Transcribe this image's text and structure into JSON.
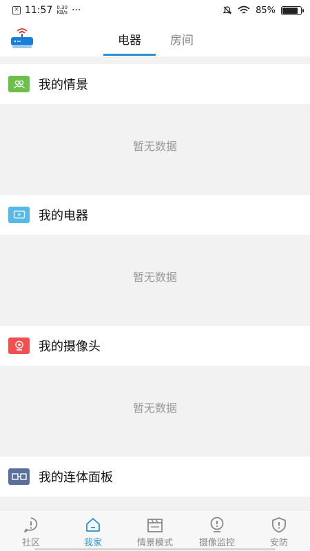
{
  "status_bar": {
    "time": "11:57",
    "speed_value": "0.30",
    "speed_unit": "KB/s",
    "dots": "···",
    "battery": "85%"
  },
  "tabs": [
    {
      "label": "电器",
      "active": true
    },
    {
      "label": "房间",
      "active": false
    }
  ],
  "sections": [
    {
      "title": "我的情景",
      "icon": "people-icon",
      "icon_color": "#6cc04a",
      "empty_text": "暂无数据"
    },
    {
      "title": "我的电器",
      "icon": "tv-icon",
      "icon_color": "#56b8e6",
      "empty_text": "暂无数据"
    },
    {
      "title": "我的摄像头",
      "icon": "camera-icon",
      "icon_color": "#f05050",
      "empty_text": "暂无数据"
    },
    {
      "title": "我的连体面板",
      "icon": "panel-icon",
      "icon_color": "#5a6f9a",
      "empty_text": ""
    }
  ],
  "nav": [
    {
      "label": "社区",
      "icon": "community-icon",
      "active": false
    },
    {
      "label": "我家",
      "icon": "home-icon",
      "active": true
    },
    {
      "label": "情景模式",
      "icon": "clapper-icon",
      "active": false
    },
    {
      "label": "摄像监控",
      "icon": "monitor-icon",
      "active": false
    },
    {
      "label": "安防",
      "icon": "shield-icon",
      "active": false
    }
  ],
  "colors": {
    "accent": "#2a8fd6",
    "inactive": "#888888"
  }
}
